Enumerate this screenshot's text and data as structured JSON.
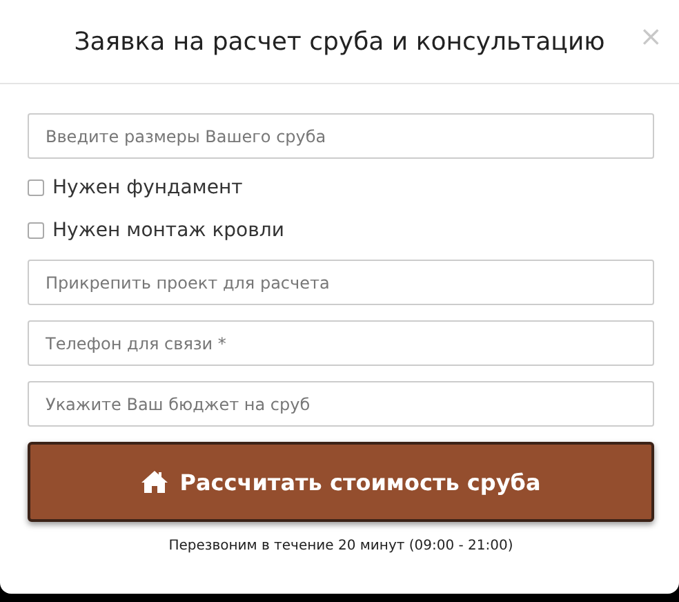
{
  "dialog": {
    "title": "Заявка на расчет сруба и консультацию",
    "close": "×"
  },
  "fields": [
    {
      "kind": "input",
      "placeholder": "Введите размеры Вашего сруба"
    },
    {
      "kind": "checkbox",
      "label": "Нужен фундамент",
      "checked": false
    },
    {
      "kind": "checkbox",
      "label": "Нужен монтаж кровли",
      "checked": false
    },
    {
      "kind": "input",
      "placeholder": "Прикрепить проект для расчета"
    },
    {
      "kind": "input",
      "placeholder": "Телефон для связи *"
    },
    {
      "kind": "input",
      "placeholder": "Укажите Ваш бюджет на сруб"
    }
  ],
  "submit": {
    "label": "Рассчитать стоимость сруба"
  },
  "note": "Перезвоним в течение 20 минут (09:00 - 21:00)"
}
